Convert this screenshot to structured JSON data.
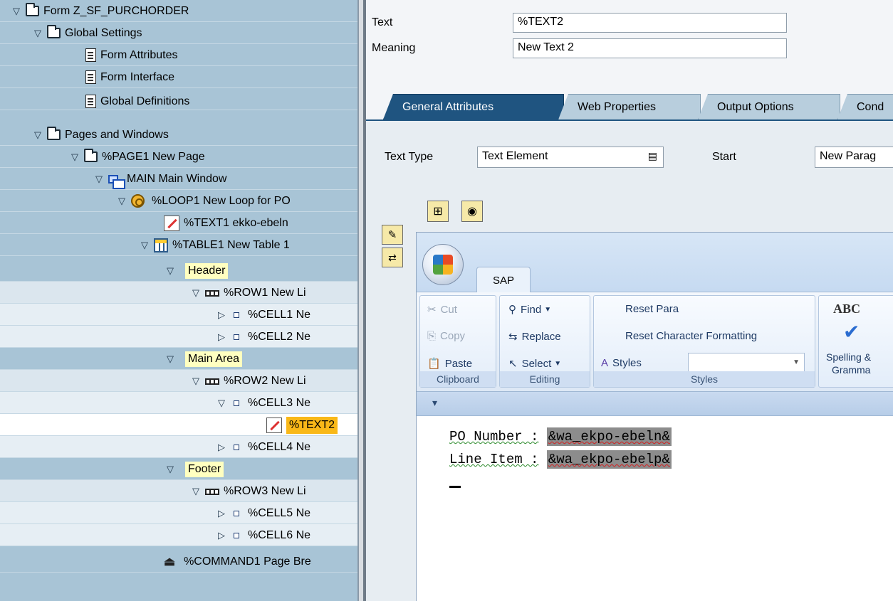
{
  "tree": {
    "items": [
      {
        "label": "Form Z_SF_PURCHORDER",
        "toggle": "▽",
        "icon": "folder-icon"
      },
      {
        "label": "Global Settings",
        "toggle": "▽",
        "icon": "folder-icon"
      },
      {
        "label": "Form Attributes",
        "toggle": "",
        "icon": "document-icon"
      },
      {
        "label": "Form Interface",
        "toggle": "",
        "icon": "document-icon"
      },
      {
        "label": "Global Definitions",
        "toggle": "",
        "icon": "document-icon"
      },
      {
        "label": "Pages and Windows",
        "toggle": "▽",
        "icon": "folder-icon"
      },
      {
        "label": "%PAGE1 New Page",
        "toggle": "▽",
        "icon": "folder-icon"
      },
      {
        "label": "MAIN Main Window",
        "toggle": "▽",
        "icon": "window-icon"
      },
      {
        "label": "%LOOP1 New Loop for PO",
        "toggle": "▽",
        "icon": "loop-icon"
      },
      {
        "label": "%TEXT1 ekko-ebeln",
        "toggle": "",
        "icon": "text-node-icon"
      },
      {
        "label": "%TABLE1 New Table 1",
        "toggle": "▽",
        "icon": "table-icon"
      },
      {
        "label": "Header",
        "toggle": "▽",
        "icon": ""
      },
      {
        "label": "%ROW1 New Li",
        "toggle": "▽",
        "icon": "row-icon"
      },
      {
        "label": "%CELL1 Ne",
        "toggle": "▷",
        "icon": "cell-icon"
      },
      {
        "label": "%CELL2 Ne",
        "toggle": "▷",
        "icon": "cell-icon"
      },
      {
        "label": "Main Area",
        "toggle": "▽",
        "icon": ""
      },
      {
        "label": "%ROW2 New Li",
        "toggle": "▽",
        "icon": "row-icon"
      },
      {
        "label": "%CELL3 Ne",
        "toggle": "▽",
        "icon": "cell-icon"
      },
      {
        "label": "%TEXT2",
        "toggle": "",
        "icon": "text-node-icon"
      },
      {
        "label": "%CELL4 Ne",
        "toggle": "▷",
        "icon": "cell-icon"
      },
      {
        "label": "Footer",
        "toggle": "▽",
        "icon": ""
      },
      {
        "label": "%ROW3 New Li",
        "toggle": "▽",
        "icon": "row-icon"
      },
      {
        "label": "%CELL5 Ne",
        "toggle": "▷",
        "icon": "cell-icon"
      },
      {
        "label": "%CELL6 Ne",
        "toggle": "▷",
        "icon": "cell-icon"
      },
      {
        "label": "%COMMAND1 Page Bre",
        "toggle": "",
        "icon": "command-icon"
      }
    ]
  },
  "fields": {
    "text_label": "Text",
    "text_value": "%TEXT2",
    "meaning_label": "Meaning",
    "meaning_value": "New Text 2"
  },
  "tabs": [
    "General Attributes",
    "Web Properties",
    "Output Options",
    "Cond"
  ],
  "attributes": {
    "text_type_label": "Text Type",
    "text_type_value": "Text Element",
    "start_label": "Start",
    "start_value": "New Parag"
  },
  "editor": {
    "tab": "SAP",
    "clipboard": {
      "cut": "Cut",
      "copy": "Copy",
      "paste": "Paste",
      "group": "Clipboard"
    },
    "editing": {
      "find": "Find",
      "replace": "Replace",
      "select": "Select",
      "group": "Editing"
    },
    "styles": {
      "reset_para": "Reset Para",
      "reset_char": "Reset Character Formatting",
      "styles": "Styles",
      "group": "Styles"
    },
    "proofing": {
      "abc": "ABC",
      "spelling": "Spelling &",
      "grammar": "Gramma"
    },
    "lines": [
      {
        "label": "PO Number :",
        "var": "&wa_ekpo-ebeln&"
      },
      {
        "label": "Line Item :",
        "var": "&wa_ekpo-ebelp&"
      }
    ]
  }
}
